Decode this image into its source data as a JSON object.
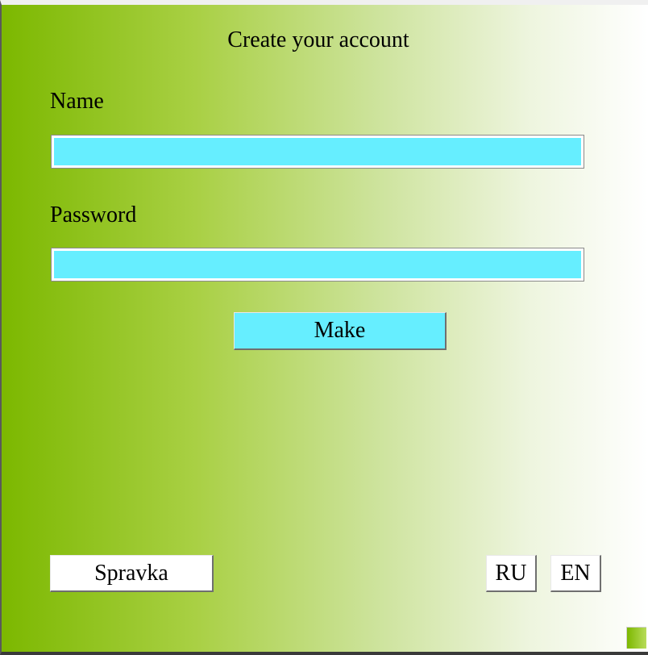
{
  "form": {
    "title": "Create your account",
    "name_label": "Name",
    "name_value": "",
    "password_label": "Password",
    "password_value": "",
    "submit_label": "Make"
  },
  "footer": {
    "help_label": "Spravka",
    "lang_ru_label": "RU",
    "lang_en_label": "EN"
  },
  "colors": {
    "gradient_start": "#7cb800",
    "gradient_end": "#ffffff",
    "input_fill": "#66eeff",
    "button_fill": "#66eeff"
  }
}
